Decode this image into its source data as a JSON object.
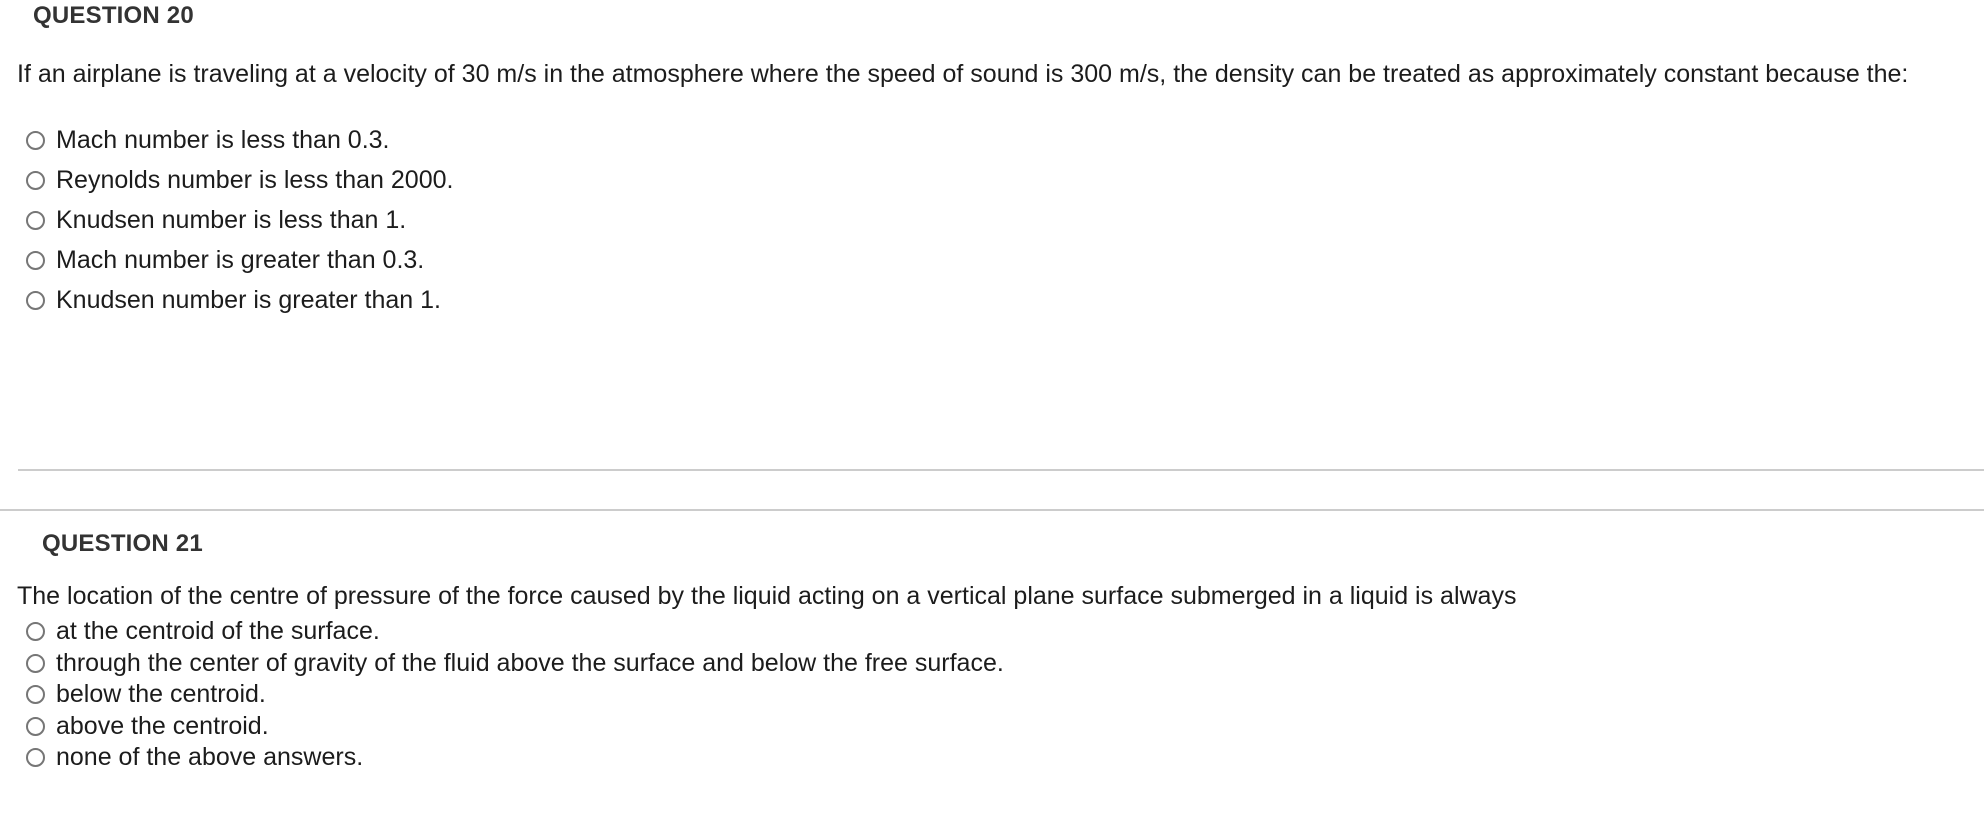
{
  "questions": [
    {
      "header": "QUESTION 20",
      "body": "If an airplane is traveling at a velocity of 30 m/s in the atmosphere where the speed of sound is 300 m/s, the density can be treated as approximately constant because the:",
      "options": [
        {
          "label": "Mach number is less than 0.3.",
          "selected": false
        },
        {
          "label": "Reynolds number is less than 2000.",
          "selected": false
        },
        {
          "label": "Knudsen number is less than 1.",
          "selected": false
        },
        {
          "label": "Mach number is greater than 0.3.",
          "selected": false
        },
        {
          "label": "Knudsen number is greater than 1.",
          "selected": false
        }
      ]
    },
    {
      "header": "QUESTION 21",
      "body": "The location of the centre of pressure of the force caused by the liquid acting on a vertical plane surface submerged in a liquid is always",
      "options": [
        {
          "label": "at the centroid of the surface.",
          "selected": false
        },
        {
          "label": "through the center of gravity of the fluid above the surface and below the free surface.",
          "selected": false
        },
        {
          "label": "below the centroid.",
          "selected": false
        },
        {
          "label": "above the centroid.",
          "selected": false
        },
        {
          "label": "none of the above answers.",
          "selected": false
        }
      ]
    }
  ],
  "colors": {
    "header_text": "#333333",
    "body_text": "#1c1c1c",
    "radio_border": "#767676",
    "divider": "#cccccc",
    "background": "#ffffff"
  }
}
